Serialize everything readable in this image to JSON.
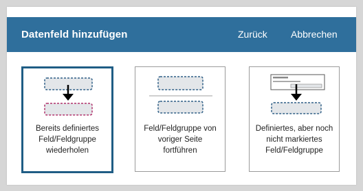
{
  "header": {
    "title": "Datenfeld hinzufügen",
    "back_label": "Zurück",
    "cancel_label": "Abbrechen"
  },
  "cards": [
    {
      "lines": [
        "Bereits definiertes",
        "Feld/Feldgruppe",
        "wiederholen"
      ],
      "selected": true
    },
    {
      "lines": [
        "Feld/Feldgruppe von",
        "voriger Seite",
        "fortführen"
      ],
      "selected": false
    },
    {
      "lines": [
        "Definiertes, aber noch",
        "nicht markiertes",
        "Feld/Feldgruppe"
      ],
      "selected": false
    }
  ],
  "colors": {
    "header": "#2f6f9c",
    "selected_border": "#1f5d85",
    "dashed_blue": "#2f5f86",
    "dashed_magenta": "#b0306b"
  }
}
